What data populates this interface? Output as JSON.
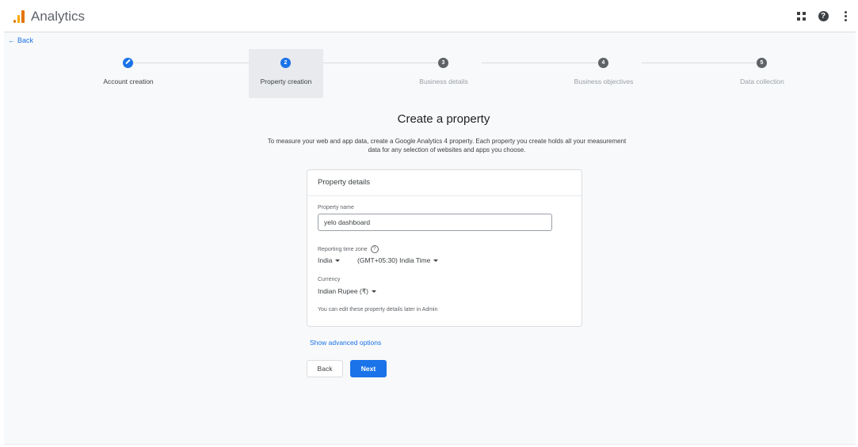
{
  "header": {
    "app_title": "Analytics",
    "icons": [
      "apps-grid-icon",
      "help-icon",
      "more-vert-icon"
    ]
  },
  "nav": {
    "back_label": "Back"
  },
  "stepper": {
    "steps": [
      {
        "number": "1",
        "label": "Account creation",
        "state": "completed"
      },
      {
        "number": "2",
        "label": "Property creation",
        "state": "active"
      },
      {
        "number": "3",
        "label": "Business details",
        "state": "pending"
      },
      {
        "number": "4",
        "label": "Business objectives",
        "state": "pending"
      },
      {
        "number": "5",
        "label": "Data collection",
        "state": "pending"
      }
    ]
  },
  "main": {
    "title": "Create a property",
    "description": "To measure your web and app data, create a Google Analytics 4 property. Each property you create holds all your measurement data for any selection of websites and apps you choose."
  },
  "card": {
    "heading": "Property details",
    "property_name_label": "Property name",
    "property_name_value": "yelo dashboard",
    "timezone_label": "Reporting time zone",
    "timezone_country": "India",
    "timezone_value": "(GMT+05:30) India Time",
    "currency_label": "Currency",
    "currency_value": "Indian Rupee (₹)",
    "hint": "You can edit these property details later in Admin"
  },
  "actions": {
    "advanced_label": "Show advanced options",
    "back_label": "Back",
    "next_label": "Next"
  },
  "colors": {
    "accent": "#1a73e8",
    "step_pending": "#5f6368",
    "logo_orange": "#e37400",
    "logo_yellow": "#f9ab00"
  }
}
